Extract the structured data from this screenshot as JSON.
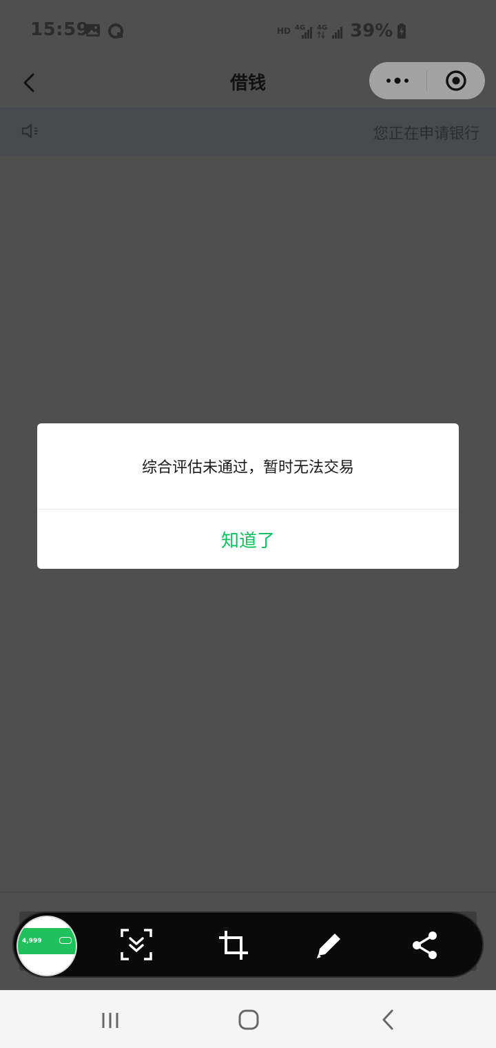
{
  "status_bar": {
    "time": "15:59",
    "network_label": "HD",
    "sim1": "4G",
    "sim2": "4G",
    "battery": "39%"
  },
  "nav": {
    "title": "借钱"
  },
  "notice": {
    "text": "您正在申请银行"
  },
  "dialog": {
    "message": "综合评估未通过，暂时无法交易",
    "confirm_label": "知道了"
  },
  "thumbnail": {
    "amount": "4,999"
  },
  "colors": {
    "accent_green": "#07c160",
    "overlay": "#4f4f4f"
  },
  "icons": {
    "back": "chevron-left-icon",
    "more": "more-dots-icon",
    "close": "target-close-icon",
    "notice": "speaker-icon",
    "scroll_capture": "scroll-capture-icon",
    "crop": "crop-icon",
    "edit": "pen-icon",
    "share": "share-icon"
  }
}
